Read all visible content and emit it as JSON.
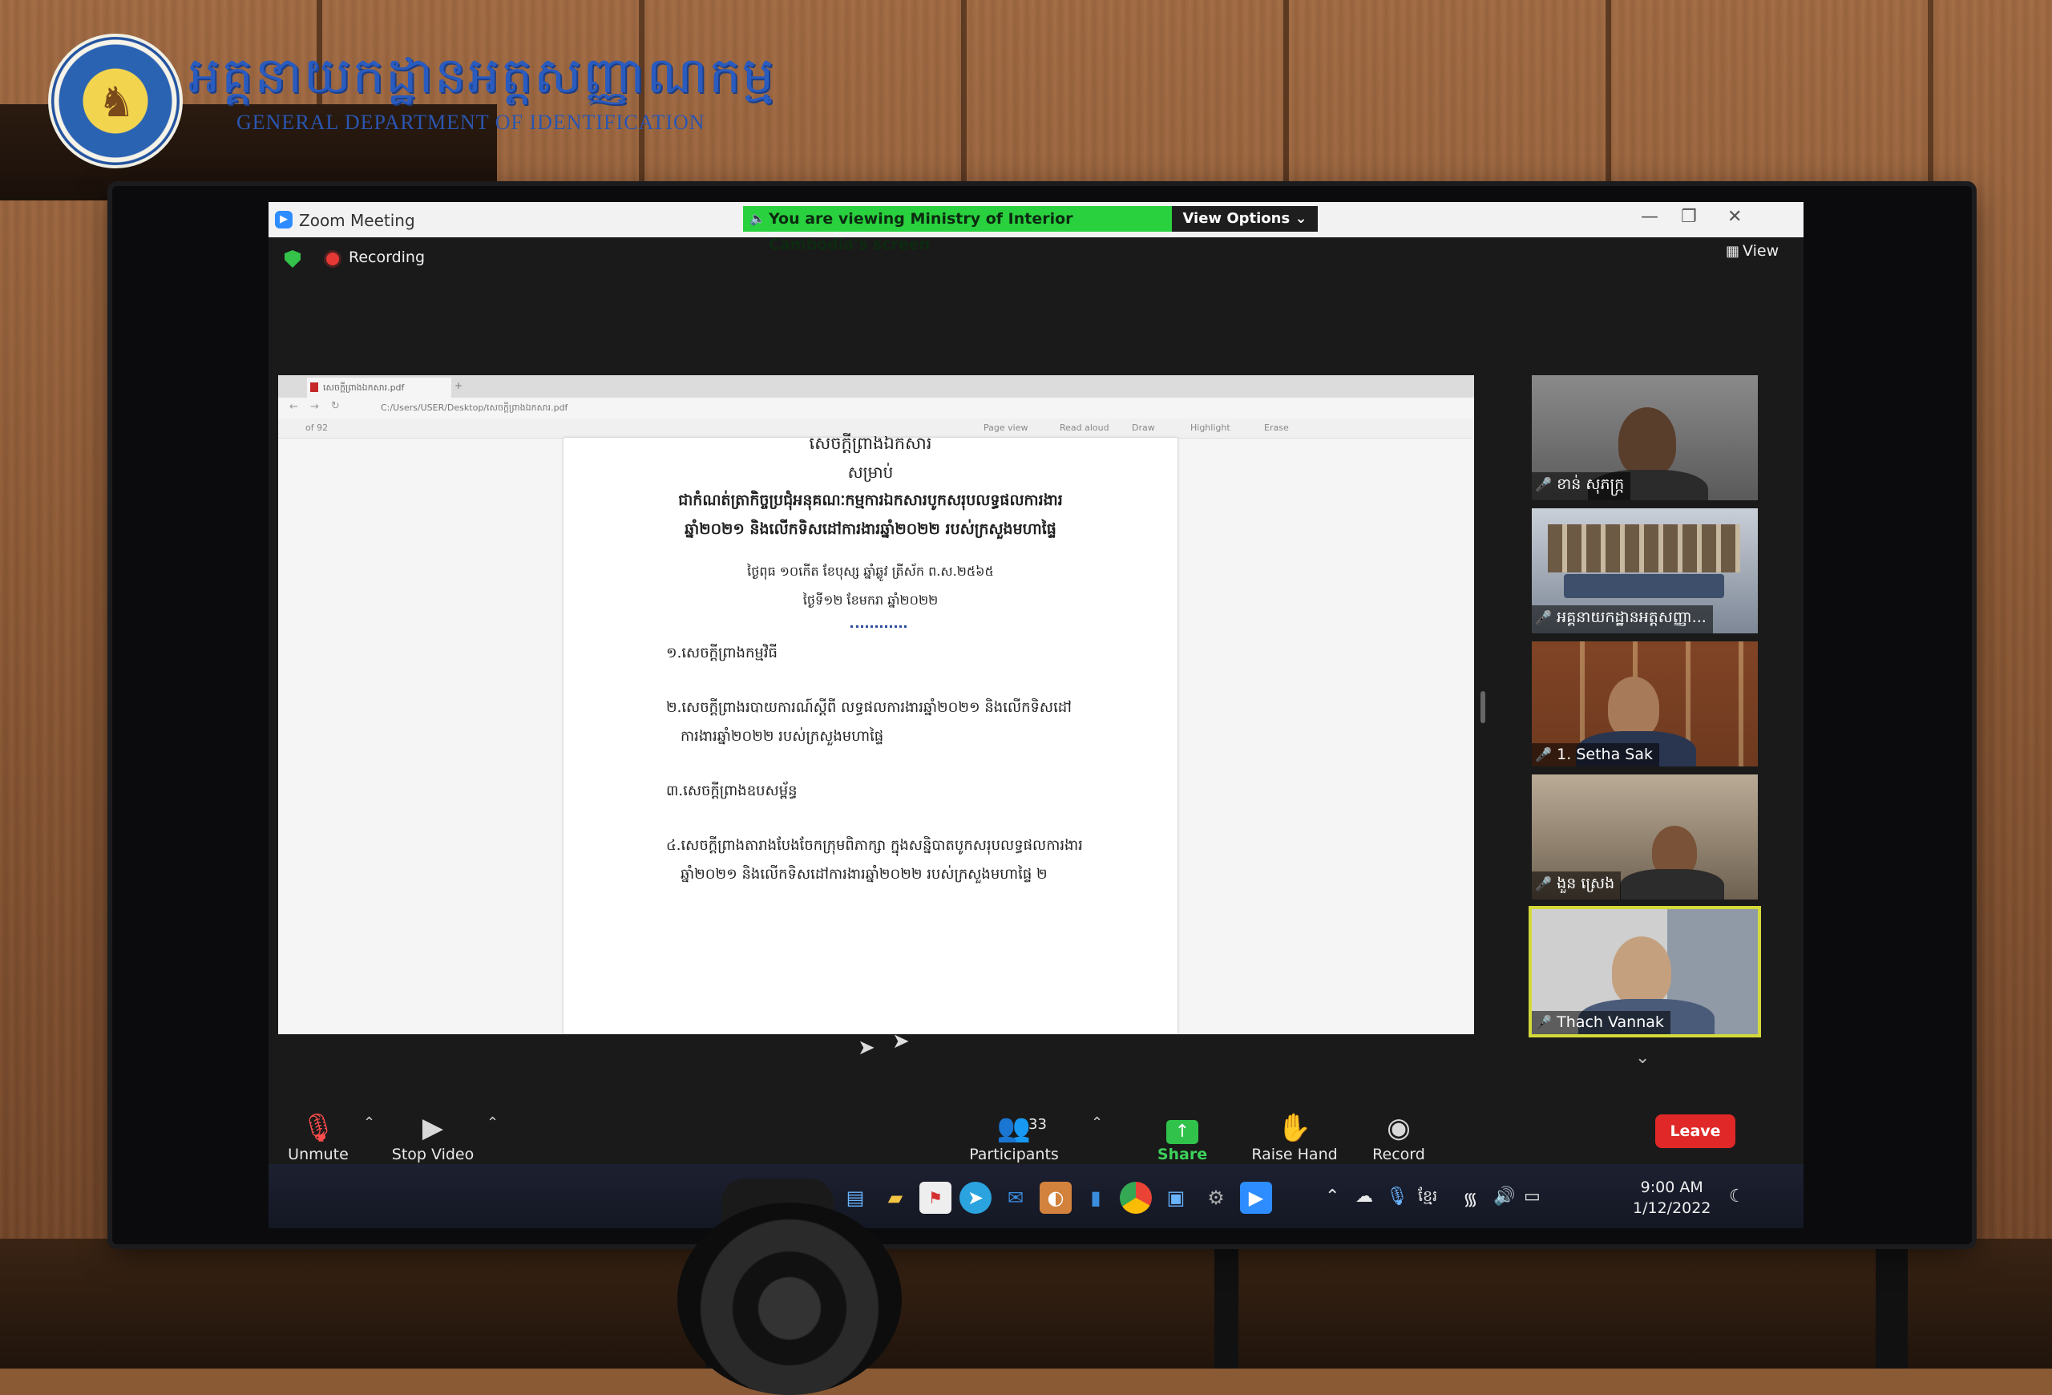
{
  "logo": {
    "khmer": "អគ្គនាយកដ្ឋានអត្តសញ្ញាណកម្ម",
    "english": "GENERAL DEPARTMENT OF IDENTIFICATION"
  },
  "zoom": {
    "window_title": "Zoom Meeting",
    "share_banner": "You are viewing Ministry of Interior Cambodia's screen",
    "view_options": "View Options",
    "recording_label": "Recording",
    "view_label": "View"
  },
  "pdf": {
    "tab_title": "សេចក្តីព្រាងឯកសារ.pdf",
    "address": "C:/Users/USER/Desktop/សេចក្តីព្រាងឯកសារ.pdf",
    "page_count": "of 92",
    "toolbar": [
      "Page view",
      "Read aloud",
      "Draw",
      "Highlight",
      "Erase"
    ],
    "document": {
      "title": "សេចក្តីព្រាងឯកសារ",
      "line2": "សម្រាប់",
      "line3": "ជាកំណត់ត្រាកិច្ចប្រជុំអនុគណៈកម្មការឯកសារបូកសរុបលទ្ធផលការងារ",
      "line4": "ឆ្នាំ២០២១ និងលើកទិសដៅការងារឆ្នាំ២០២២ របស់ក្រសួងមហាផ្ទៃ",
      "date1": "ថ្ងៃពុធ ១០កើត ខែបុស្ស ឆ្នាំឆ្លូវ ត្រីស័ក ព.ស.២៥៦៥",
      "date2": "ថ្ងៃទី១២ ខែមករា ឆ្នាំ២០២២",
      "item1": "១.សេចក្តីព្រាងកម្មវិធី",
      "item2a": "២.សេចក្តីព្រាងរបាយការណ៍ស្តីពី លទ្ធផលការងារឆ្នាំ២០២១ និងលើកទិសដៅ",
      "item2b": "ការងារឆ្នាំ២០២២ របស់ក្រសួងមហាផ្ទៃ",
      "item3": "៣.សេចក្តីព្រាងឧបសម្ព័ន្ធ",
      "item4a": "៤.សេចក្តីព្រាងតារាងបែងចែកក្រុមពិភាក្សា ក្នុងសន្និបាតបូកសរុបលទ្ធផលការងារ",
      "item4b": "ឆ្នាំ២០២១ និងលើកទិសដៅការងារឆ្នាំ២០២២ របស់ក្រសួងមហាផ្ទៃ ២"
    }
  },
  "participants": [
    {
      "name": "ខាន់ សុភក្រ្ក"
    },
    {
      "name": "អគ្គនាយកដ្ឋានអត្តសញ្ញា..."
    },
    {
      "name": "1. Setha Sak"
    },
    {
      "name": "ងួន ស្រេង"
    },
    {
      "name": "Thach Vannak"
    }
  ],
  "controls": {
    "unmute": "Unmute",
    "stop_video": "Stop Video",
    "participants": "Participants",
    "participants_count": "33",
    "share_screen": "Share Screen",
    "raise_hand": "Raise Hand",
    "record": "Record",
    "leave": "Leave"
  },
  "taskbar": {
    "language": "ខ្មែរ",
    "time": "9:00 AM",
    "date": "1/12/2022"
  },
  "colors": {
    "share_green": "#29d13f",
    "leave_red": "#e02828",
    "speaker_highlight": "#d4d93a",
    "zoom_blue": "#2d8cff"
  }
}
